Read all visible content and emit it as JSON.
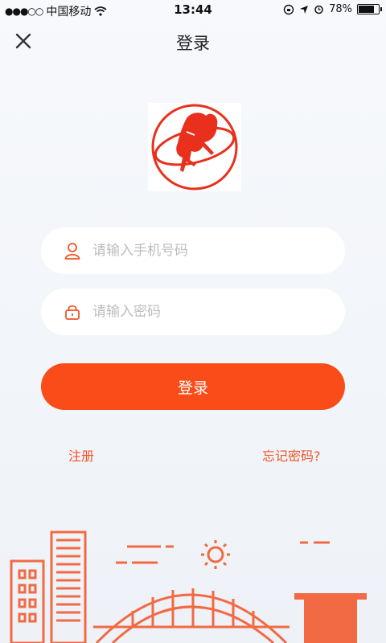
{
  "status_bar": {
    "signal_dots": "●●●○○",
    "carrier": "中国移动",
    "time": "13:44",
    "battery_percent": "78%",
    "battery_level": 0.78
  },
  "nav": {
    "title": "登录"
  },
  "form": {
    "phone_placeholder": "请输入手机号码",
    "password_placeholder": "请输入密码",
    "login_label": "登录"
  },
  "links": {
    "register": "注册",
    "forgot": "忘记密码?"
  },
  "colors": {
    "accent": "#fa4c18",
    "link": "#f05428",
    "illustration": "#f26a44"
  },
  "icons": [
    "close-icon",
    "user-icon",
    "lock-icon",
    "wifi-icon",
    "location-icon",
    "alarm-icon"
  ]
}
